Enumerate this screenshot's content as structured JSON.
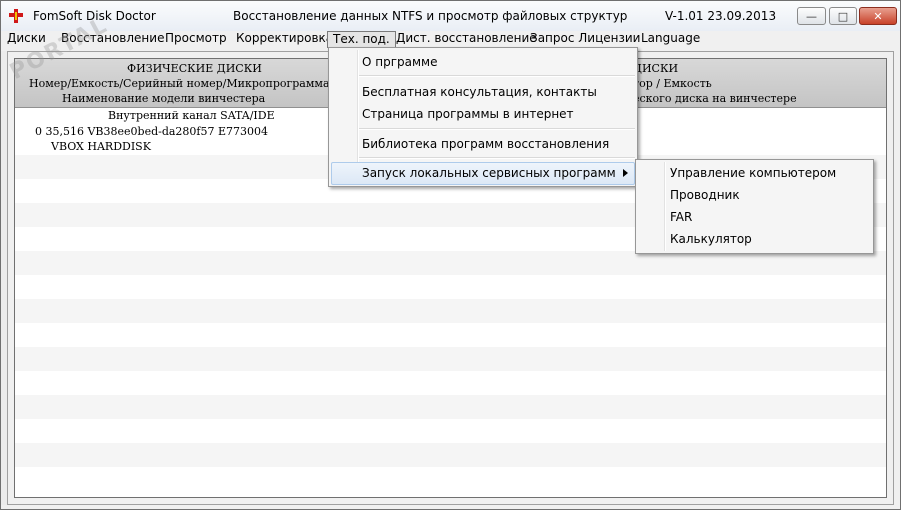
{
  "titlebar": {
    "app_title": "FomSoft Disk Doctor",
    "center_title": "Восстановление данных NTFS и просмотр файловых структур",
    "version": "V-1.01  23.09.2013"
  },
  "window_buttons": {
    "minimize": "—",
    "maximize": "□",
    "close": "✕"
  },
  "menubar": {
    "items": [
      "Диски",
      "Восстановление",
      "Просмотр",
      "Корректировка",
      "Тех. под.",
      "Дист. восстановление",
      "Запрос Лицензии",
      "Language"
    ]
  },
  "panel": {
    "left_title": "ФИЗИЧЕСКИЕ ДИСКИ",
    "left_col1": "Номер/Емкость/Серийный номер/Микропрограмма",
    "left_col2": "Наименование модели винчестера",
    "right_title": "ДИСКИ",
    "right_col1": "тор / Емкость",
    "right_col2": "еского диска на винчестере",
    "channel": "Внутренний канал SATA/IDE",
    "disk_row": "0   35,516  VB38ee0bed-da280f57   E773004",
    "disk_model": "VBOX HARDDISK"
  },
  "watermark": "PORTAL",
  "dropdown": {
    "items": [
      "О прграмме",
      "Бесплатная консультация, контакты",
      "Страница программы в интернет",
      "Библиотека программ восстановления",
      "Запуск локальных сервисных программ"
    ]
  },
  "submenu": {
    "items": [
      "Управление компьютером",
      "Проводник",
      "FAR",
      "Калькулятор"
    ]
  },
  "colors": {
    "highlight": "#dce8f6",
    "close_button": "#c8422a"
  }
}
